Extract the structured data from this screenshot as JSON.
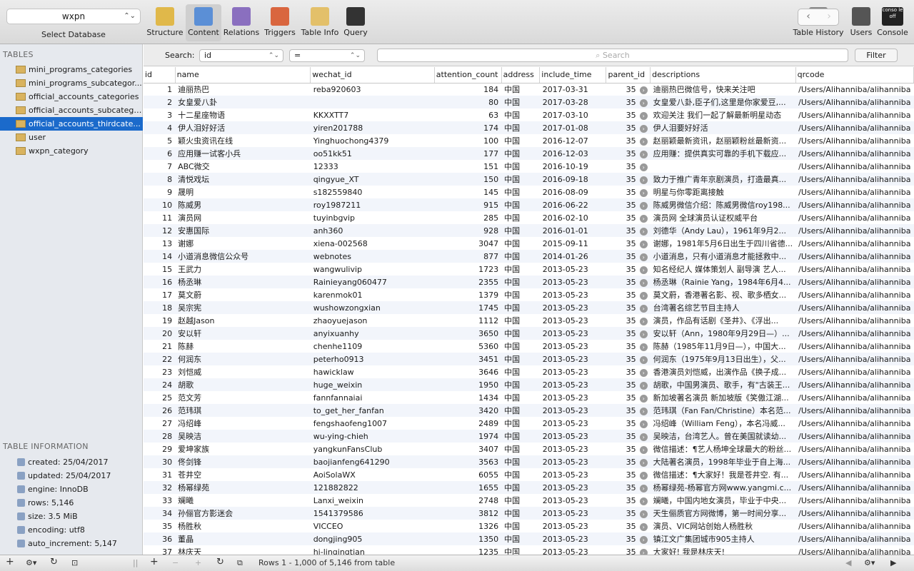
{
  "db": {
    "name": "wxpn",
    "label": "Select Database"
  },
  "toolbar": [
    {
      "label": "Structure",
      "icon": "structure-icon"
    },
    {
      "label": "Content",
      "icon": "content-icon"
    },
    {
      "label": "Relations",
      "icon": "relations-icon"
    },
    {
      "label": "Triggers",
      "icon": "triggers-icon"
    },
    {
      "label": "Table Info",
      "icon": "table-info-icon"
    },
    {
      "label": "Query",
      "icon": "query-icon"
    },
    {
      "label": "Table History",
      "icon": "table-history-icon"
    },
    {
      "label": "Users",
      "icon": "users-icon"
    },
    {
      "label": "Console",
      "icon": "console-icon",
      "badge": "conso le off"
    }
  ],
  "tables_title": "TABLES",
  "tables": [
    "mini_programs_categories",
    "mini_programs_subcategor...",
    "official_accounts_categories",
    "official_accounts_subcatego...",
    "official_accounts_thirdcate...",
    "user",
    "wxpn_category"
  ],
  "info_title": "TABLE INFORMATION",
  "info": [
    "created: 25/04/2017",
    "updated: 25/04/2017",
    "engine: InnoDB",
    "rows: 5,146",
    "size: 3.5 MiB",
    "encoding: utf8",
    "auto_increment: 5,147"
  ],
  "search": {
    "label": "Search:",
    "field": "id",
    "op": "=",
    "placeholder": "Search",
    "filter": "Filter"
  },
  "columns": [
    "id",
    "name",
    "wechat_id",
    "attention_count",
    "address",
    "include_time",
    "parent_id",
    "descriptions",
    "qrcode"
  ],
  "rows": [
    [
      "1",
      "迪丽热巴",
      "reba920603",
      "184",
      "中国",
      "2017-03-31",
      "35",
      "迪丽热巴微信号，快来关注吧",
      "/Users/Alihanniba/alihanniba"
    ],
    [
      "2",
      "女皇爱八卦",
      "",
      "80",
      "中国",
      "2017-03-28",
      "35",
      "女皇爱八卦,臣子们,这里是你家爱豆,...",
      "/Users/Alihanniba/alihanniba"
    ],
    [
      "3",
      "十二星座物语",
      "KKXXTT7",
      "63",
      "中国",
      "2017-03-10",
      "35",
      "欢迎关注 我们一起了解最新明星动态",
      "/Users/Alihanniba/alihanniba"
    ],
    [
      "4",
      "伊人泪好好活",
      "yiren201788",
      "174",
      "中国",
      "2017-01-08",
      "35",
      "伊人泪要好好活",
      "/Users/Alihanniba/alihanniba"
    ],
    [
      "5",
      "颖火虫资讯在线",
      "Yinghuochong4379",
      "100",
      "中国",
      "2016-12-07",
      "35",
      "赵丽颖最新资讯，赵丽颖粉丝最新资...",
      "/Users/Alihanniba/alihanniba"
    ],
    [
      "6",
      "应用赚一试客小兵",
      "oo51kk51",
      "177",
      "中国",
      "2016-12-03",
      "35",
      "应用赚：提供真实可靠的手机下载应...",
      "/Users/Alihanniba/alihanniba"
    ],
    [
      "7",
      "ABC微交",
      "12333",
      "151",
      "中国",
      "2016-10-19",
      "35",
      "",
      "/Users/Alihanniba/alihanniba"
    ],
    [
      "8",
      "清悦戏坛",
      "qingyue_XT",
      "150",
      "中国",
      "2016-09-18",
      "35",
      "致力于推广青年京剧演员，打造最真...",
      "/Users/Alihanniba/alihanniba"
    ],
    [
      "9",
      "晟明",
      "s182559840",
      "145",
      "中国",
      "2016-08-09",
      "35",
      "明星与你零距离接触",
      "/Users/Alihanniba/alihanniba"
    ],
    [
      "10",
      "陈威男",
      "roy1987211",
      "915",
      "中国",
      "2016-06-22",
      "35",
      "陈威男微信介绍：陈威男微信roy198...",
      "/Users/Alihanniba/alihanniba"
    ],
    [
      "11",
      "演员网",
      "tuyinbgvip",
      "285",
      "中国",
      "2016-02-10",
      "35",
      "演员网 全球演员认证权威平台",
      "/Users/Alihanniba/alihanniba"
    ],
    [
      "12",
      "安惠国际",
      "anh360",
      "928",
      "中国",
      "2016-01-01",
      "35",
      "刘德华（Andy Lau），1961年9月2...",
      "/Users/Alihanniba/alihanniba"
    ],
    [
      "13",
      "谢娜",
      "xiena-002568",
      "3047",
      "中国",
      "2015-09-11",
      "35",
      "谢娜，1981年5月6日出生于四川省德...",
      "/Users/Alihanniba/alihanniba"
    ],
    [
      "14",
      "小道消息微信公众号",
      "webnotes",
      "877",
      "中国",
      "2014-01-26",
      "35",
      "小道消息，只有小道消息才能拯救中...",
      "/Users/Alihanniba/alihanniba"
    ],
    [
      "15",
      "王武力",
      "wangwulivip",
      "1723",
      "中国",
      "2013-05-23",
      "35",
      "知名经纪人 媒体策划人 副导演 艺人...",
      "/Users/Alihanniba/alihanniba"
    ],
    [
      "16",
      "杨丞琳",
      "Rainieyang060477",
      "2355",
      "中国",
      "2013-05-23",
      "35",
      "杨丞琳（Rainie Yang，1984年6月4...",
      "/Users/Alihanniba/alihanniba"
    ],
    [
      "17",
      "莫文蔚",
      "karenmok01",
      "1379",
      "中国",
      "2013-05-23",
      "35",
      "莫文蔚，香港著名影、视、歌多栖女...",
      "/Users/Alihanniba/alihanniba"
    ],
    [
      "18",
      "吴宗宪",
      "wushowzongxian",
      "1745",
      "中国",
      "2013-05-23",
      "35",
      "台湾著名综艺节目主持人",
      "/Users/Alihanniba/alihanniba"
    ],
    [
      "19",
      "赵越Jason",
      "zhaoyuejason",
      "1112",
      "中国",
      "2013-05-23",
      "35",
      "演员，作品有话剧《圣井》、《浮出...",
      "/Users/Alihanniba/alihanniba"
    ],
    [
      "20",
      "安以轩",
      "anyixuanhy",
      "3650",
      "中国",
      "2013-05-23",
      "35",
      "安以轩（Ann，1980年9月29日—）...",
      "/Users/Alihanniba/alihanniba"
    ],
    [
      "21",
      "陈赫",
      "chenhe1109",
      "5360",
      "中国",
      "2013-05-23",
      "35",
      "陈赫（1985年11月9日—），中国大...",
      "/Users/Alihanniba/alihanniba"
    ],
    [
      "22",
      "何润东",
      "peterho0913",
      "3451",
      "中国",
      "2013-05-23",
      "35",
      "何润东（1975年9月13日出生），父...",
      "/Users/Alihanniba/alihanniba"
    ],
    [
      "23",
      "刘恺威",
      "hawicklaw",
      "3646",
      "中国",
      "2013-05-23",
      "35",
      "香港演员刘恺威，出演作品《换子成...",
      "/Users/Alihanniba/alihanniba"
    ],
    [
      "24",
      "胡歌",
      "huge_weixin",
      "1950",
      "中国",
      "2013-05-23",
      "35",
      "胡歌，中国男演员、歌手，有\"古装王...",
      "/Users/Alihanniba/alihanniba"
    ],
    [
      "25",
      "范文芳",
      "fannfannaiai",
      "1434",
      "中国",
      "2013-05-23",
      "35",
      "新加坡著名演员 新加坡版《笑傲江湖...",
      "/Users/Alihanniba/alihanniba"
    ],
    [
      "26",
      "范玮琪",
      "to_get_her_fanfan",
      "3420",
      "中国",
      "2013-05-23",
      "35",
      "范玮琪（Fan Fan/Christine）本名范...",
      "/Users/Alihanniba/alihanniba"
    ],
    [
      "27",
      "冯绍峰",
      "fengshaofeng1007",
      "2489",
      "中国",
      "2013-05-23",
      "35",
      "冯绍峰（William Feng），本名冯威...",
      "/Users/Alihanniba/alihanniba"
    ],
    [
      "28",
      "吴映洁",
      "wu-ying-chieh",
      "1974",
      "中国",
      "2013-05-23",
      "35",
      "吴映洁，台湾艺人。曾在美国就读幼...",
      "/Users/Alihanniba/alihanniba"
    ],
    [
      "29",
      "爱坤家族",
      "yangkunFansClub",
      "3407",
      "中国",
      "2013-05-23",
      "35",
      "微信描述：¶艺人杨坤全球最大的粉丝...",
      "/Users/Alihanniba/alihanniba"
    ],
    [
      "30",
      "佟剑锋",
      "baojianfeng641290",
      "3563",
      "中国",
      "2013-05-23",
      "35",
      "大陆著名演员，1998年毕业于自上海...",
      "/Users/Alihanniba/alihanniba"
    ],
    [
      "31",
      "苍井空",
      "AoiSolaWX",
      "6055",
      "中国",
      "2013-05-23",
      "35",
      "微信描述：¶大家好！我是苍井空. 有...",
      "/Users/Alihanniba/alihanniba"
    ],
    [
      "32",
      "杨幂绿苑",
      "121882822",
      "1655",
      "中国",
      "2013-05-23",
      "35",
      "杨幂绿苑-杨幂官方网www.yangmi.c...",
      "/Users/Alihanniba/alihanniba"
    ],
    [
      "33",
      "斓曦",
      "Lanxi_weixin",
      "2748",
      "中国",
      "2013-05-23",
      "35",
      "斓曦，中国内地女演员，毕业于中央...",
      "/Users/Alihanniba/alihanniba"
    ],
    [
      "34",
      "孙俪官方影迷会",
      "1541379586",
      "3812",
      "中国",
      "2013-05-23",
      "35",
      "天生俪质官方网微博，第一时间分享...",
      "/Users/Alihanniba/alihanniba"
    ],
    [
      "35",
      "杨胜秋",
      "VICCEO",
      "1326",
      "中国",
      "2013-05-23",
      "35",
      "演员、VIC网站创始人杨胜秋",
      "/Users/Alihanniba/alihanniba"
    ],
    [
      "36",
      "董晶",
      "dongjing905",
      "1350",
      "中国",
      "2013-05-23",
      "35",
      "镇江文广集团城市905主持人",
      "/Users/Alihanniba/alihanniba"
    ],
    [
      "37",
      "林庆天",
      "hi-linqingtian",
      "1235",
      "中国",
      "2013-05-23",
      "35",
      "大家好! 我是林庆天!",
      "/Users/Alihanniba/alihanniba"
    ]
  ],
  "footer": {
    "rows_text": "Rows 1 - 1,000 of 5,146 from table"
  }
}
